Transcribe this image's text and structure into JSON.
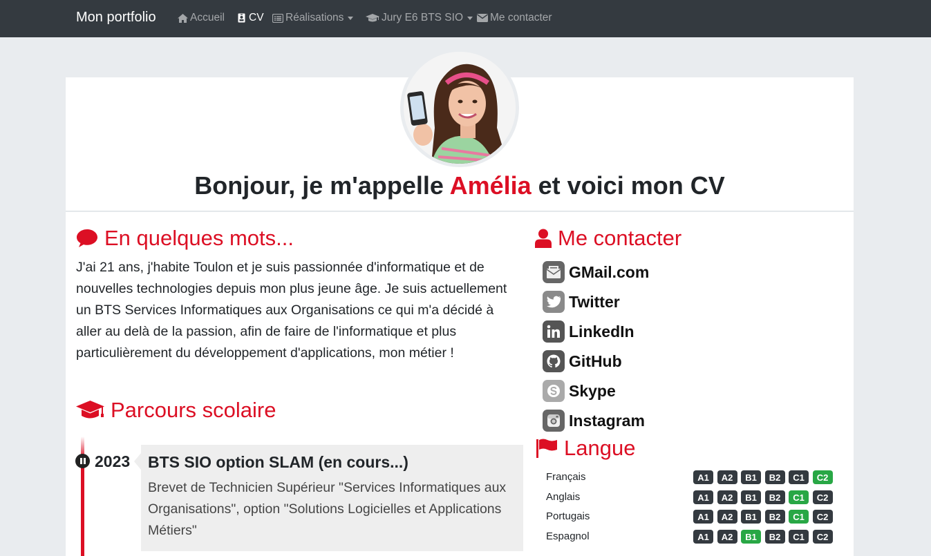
{
  "navbar": {
    "brand": "Mon portfolio",
    "items": [
      {
        "label": "Accueil",
        "icon": "home-icon",
        "active": false,
        "dropdown": false
      },
      {
        "label": "CV",
        "icon": "id-badge-icon",
        "active": true,
        "dropdown": false
      },
      {
        "label": "Réalisations",
        "icon": "list-alt-icon",
        "active": false,
        "dropdown": true
      },
      {
        "label": "Jury E6 BTS SIO",
        "icon": "graduation-cap-icon",
        "active": false,
        "dropdown": true
      },
      {
        "label": "Me contacter",
        "icon": "envelope-icon",
        "active": false,
        "dropdown": false
      }
    ]
  },
  "hero": {
    "title_before": "Bonjour, je m'appelle ",
    "title_name": "Amélia",
    "title_after": " et voici mon CV"
  },
  "about": {
    "title": "En quelques mots...",
    "text": "J'ai 21 ans, j'habite Toulon et je suis passionnée d'informatique et de nouvelles technologies depuis mon plus jeune âge. Je suis actuellement un BTS Services Informatiques aux Organisations ce qui m'a décidé à aller au delà de la passion, afin de faire de l'informatique et plus particulièrement du développement d'applications, mon métier !"
  },
  "education": {
    "title": "Parcours scolaire",
    "entries": [
      {
        "year": "2023",
        "title": "BTS SIO option SLAM (en cours...)",
        "text": "Brevet de Technicien Supérieur \"Services Informatiques aux Organisations\", option \"Solutions Logicielles et Applications Métiers\""
      }
    ]
  },
  "contact": {
    "title": "Me contacter",
    "items": [
      {
        "label": "GMail.com",
        "icon": "gmail-icon"
      },
      {
        "label": "Twitter",
        "icon": "twitter-icon"
      },
      {
        "label": "LinkedIn",
        "icon": "linkedin-icon"
      },
      {
        "label": "GitHub",
        "icon": "github-icon"
      },
      {
        "label": "Skype",
        "icon": "skype-icon"
      },
      {
        "label": "Instagram",
        "icon": "instagram-icon"
      }
    ]
  },
  "languages": {
    "title": "Langue",
    "level_labels": [
      "A1",
      "A2",
      "B1",
      "B2",
      "C1",
      "C2"
    ],
    "items": [
      {
        "name": "Français",
        "level": "C2"
      },
      {
        "name": "Anglais",
        "level": "C1"
      },
      {
        "name": "Portugais",
        "level": "C1"
      },
      {
        "name": "Espagnol",
        "level": "B1"
      }
    ]
  },
  "colors": {
    "accent": "#dc0f24",
    "navbar": "#343a40",
    "level_active": "#28a745",
    "level_inactive": "#343a40"
  }
}
